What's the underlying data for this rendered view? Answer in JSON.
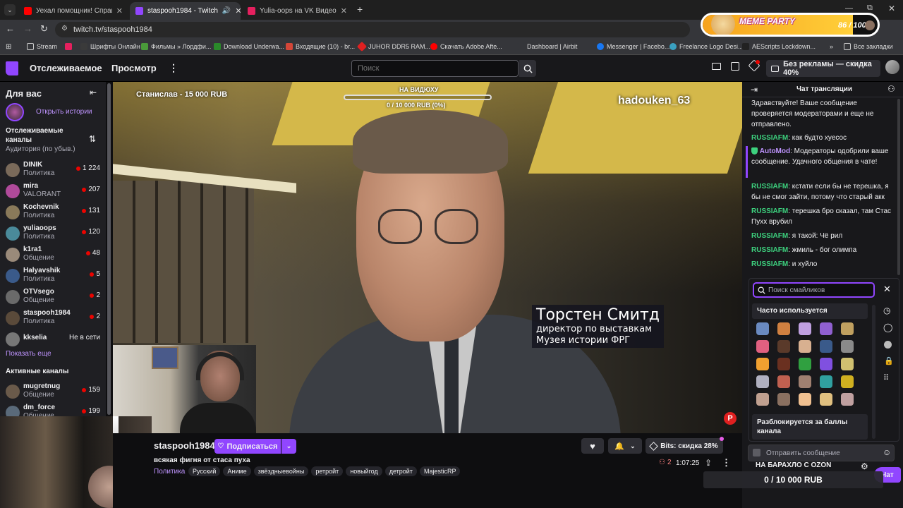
{
  "browser": {
    "tabs": [
      {
        "title": "Уехал помощник! Справляемся"
      },
      {
        "title": "staspooh1984 - Twitch"
      },
      {
        "title": "Yulia-oops на VK Видео Live -"
      }
    ],
    "url": "twitch.tv/staspooh1984",
    "bookmarks": [
      "Stream",
      "Шрифты Онлайн",
      "Фильмы » Лордфи...",
      "Download Underwa...",
      "Входящие (10) - br...",
      "JUHOR DDR5 RAM...",
      "Скачать Adobe Afte...",
      "Dashboard | Airbit",
      "Messenger | Facebo...",
      "Freelance Logo Desi...",
      "AEScripts Lockdown...",
      "»",
      "Все закладки"
    ]
  },
  "meme_party": {
    "title": "MEME PARTY",
    "count": "86 / 100",
    "progress": 0.86
  },
  "topnav": {
    "following": "Отслеживаемое",
    "browse": "Просмотр",
    "more": "⋮",
    "search_placeholder": "Поиск",
    "prime": "Без рекламы — скидка 40%"
  },
  "sidebar": {
    "for_you": "Для вас",
    "open_stories": "Открыть истории",
    "followed_title": "Отслеживаемые каналы",
    "sort": "Аудитория (по убыв.)",
    "channels": [
      {
        "name": "DINIK",
        "game": "Политика",
        "viewers": "1 224",
        "color": "#7a6a5a"
      },
      {
        "name": "mira",
        "game": "VALORANT",
        "viewers": "207",
        "color": "#b04a9a"
      },
      {
        "name": "Kochevnik",
        "game": "Политика",
        "viewers": "131",
        "color": "#8a7a5a"
      },
      {
        "name": "yuliaoops",
        "game": "Политика",
        "viewers": "120",
        "color": "#4a8a9a"
      },
      {
        "name": "k1ra1",
        "game": "Общение",
        "viewers": "48",
        "color": "#9a8a7a"
      },
      {
        "name": "Halyavshik",
        "game": "Политика",
        "viewers": "5",
        "color": "#3a5a8a"
      },
      {
        "name": "OTVsego",
        "game": "Общение",
        "viewers": "2",
        "color": "#6a6a6a"
      },
      {
        "name": "staspooh1984",
        "game": "Политика",
        "viewers": "2",
        "color": "#5a4a3a"
      }
    ],
    "offline": {
      "name": "kkselia",
      "status": "Не в сети"
    },
    "show_more": "Показать еще",
    "active_title": "Активные каналы",
    "active": [
      {
        "name": "mugretnug",
        "game": "Общение",
        "viewers": "159",
        "color": "#6a5a4a"
      },
      {
        "name": "dm_force",
        "game": "Общение",
        "viewers": "199",
        "color": "#5a6a7a"
      }
    ]
  },
  "video": {
    "donor": "Станислав - 15 000 RUB",
    "goal_title": "НА ВИДЮХУ",
    "goal_value": "0 / 10 000 RUB (0%)",
    "goal_progress": 0,
    "watermark": "hadouken_63",
    "lower_third": [
      "Торстен Смитд",
      "директор по выставкам",
      "Музея истории ФРГ"
    ]
  },
  "channel": {
    "name": "staspooh1984",
    "follow": "Подписаться",
    "bits": "Bits: скидка 28%",
    "title": "всякая фигня от стаса пуха",
    "category": "Политика",
    "tags": [
      "Русский",
      "Аниме",
      "звёздныевойны",
      "ретройт",
      "новыйгод",
      "детройт",
      "MajesticRP"
    ],
    "viewers": "2",
    "uptime": "1:07:25"
  },
  "chat": {
    "title": "Чат трансляции",
    "messages": [
      {
        "user": "",
        "text": "Здравствуйте! Ваше сообщение проверяется модераторами и еще не отправлено."
      },
      {
        "user": "RUSSIAFM",
        "text": "как будто хуесос"
      },
      {
        "user": "AutoMod",
        "text": "Модераторы одобрили ваше сообщение. Удачного общения в чате!"
      },
      {
        "user": "RUSSIAFM",
        "text": "кстати если бы не терешка, я бы не смог зайти, потому что старый акк"
      },
      {
        "user": "RUSSIAFM",
        "text": "терешка бро сказал, там Стас Пухх врубил"
      },
      {
        "user": "RUSSIAFM",
        "text": "я такой: Чё рил"
      },
      {
        "user": "RUSSIAFM",
        "text": "жмиль - бог олимпа"
      },
      {
        "user": "RUSSIAFM",
        "text": "и хуйло"
      }
    ],
    "emote_search_placeholder": "Поиск смайликов",
    "frequently_used": "Часто используется",
    "unlock_text": "Разблокируется за баллы канала",
    "send_placeholder": "Отправить сообщение",
    "chat_btn": "Чат",
    "ozon": "НА БАРАХЛО С OZON",
    "ozon_value": "0 / 10 000 RUB"
  }
}
